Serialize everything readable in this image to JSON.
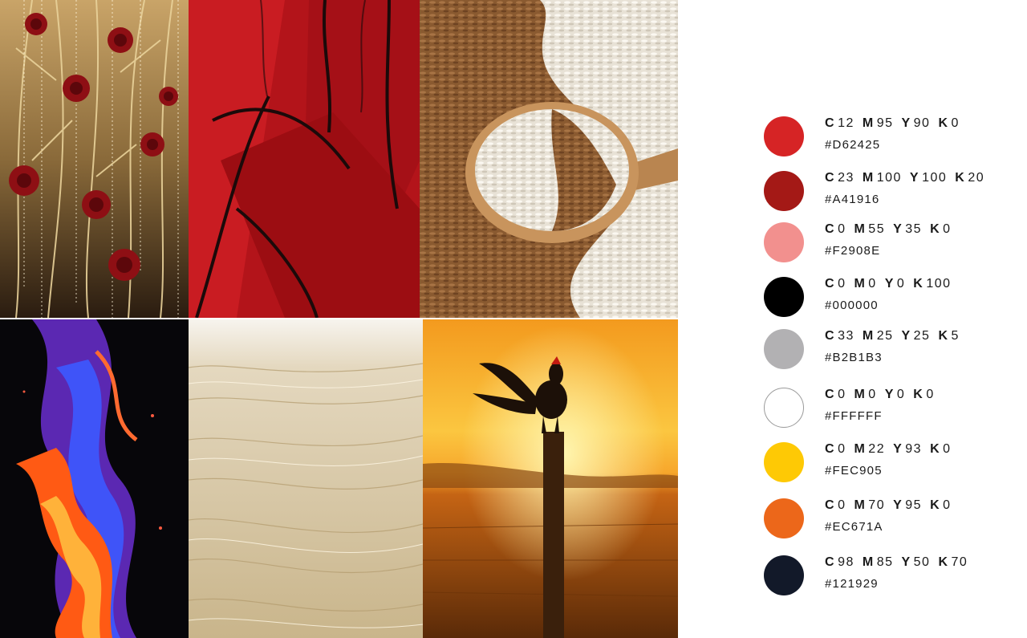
{
  "images": [
    {
      "key": "roses",
      "subject": "gold branches with red roses and crystal strands"
    },
    {
      "key": "feather",
      "subject": "red feathers close-up"
    },
    {
      "key": "rice",
      "subject": "wooden spoon of white and brown rice"
    },
    {
      "key": "flame",
      "subject": "orange and blue flames on black"
    },
    {
      "key": "wheat",
      "subject": "pale wheat field"
    },
    {
      "key": "rooster",
      "subject": "rooster silhouette on post at sunset"
    }
  ],
  "swatches": [
    {
      "c": "12",
      "m": "95",
      "y": "90",
      "k": "0",
      "hex": "#D62425",
      "color": "#D62425"
    },
    {
      "c": "23",
      "m": "100",
      "y": "100",
      "k": "20",
      "hex": "#A41916",
      "color": "#A41916"
    },
    {
      "c": "0",
      "m": "55",
      "y": "35",
      "k": "0",
      "hex": "#F2908E",
      "color": "#F2908E"
    },
    {
      "c": "0",
      "m": "0",
      "y": "0",
      "k": "100",
      "hex": "#000000",
      "color": "#000000"
    },
    {
      "c": "33",
      "m": "25",
      "y": "25",
      "k": "5",
      "hex": "#B2B1B3",
      "color": "#B2B1B3"
    },
    {
      "c": "0",
      "m": "0",
      "y": "0",
      "k": "0",
      "hex": "#FFFFFF",
      "color": "#FFFFFF"
    },
    {
      "c": "0",
      "m": "22",
      "y": "93",
      "k": "0",
      "hex": "#FEC905",
      "color": "#FEC905"
    },
    {
      "c": "0",
      "m": "70",
      "y": "95",
      "k": "0",
      "hex": "#EC671A",
      "color": "#EC671A"
    },
    {
      "c": "98",
      "m": "85",
      "y": "50",
      "k": "70",
      "hex": "#121929",
      "color": "#121929"
    }
  ],
  "labels": {
    "c": "C",
    "m": "M",
    "y": "Y",
    "k": "K"
  }
}
